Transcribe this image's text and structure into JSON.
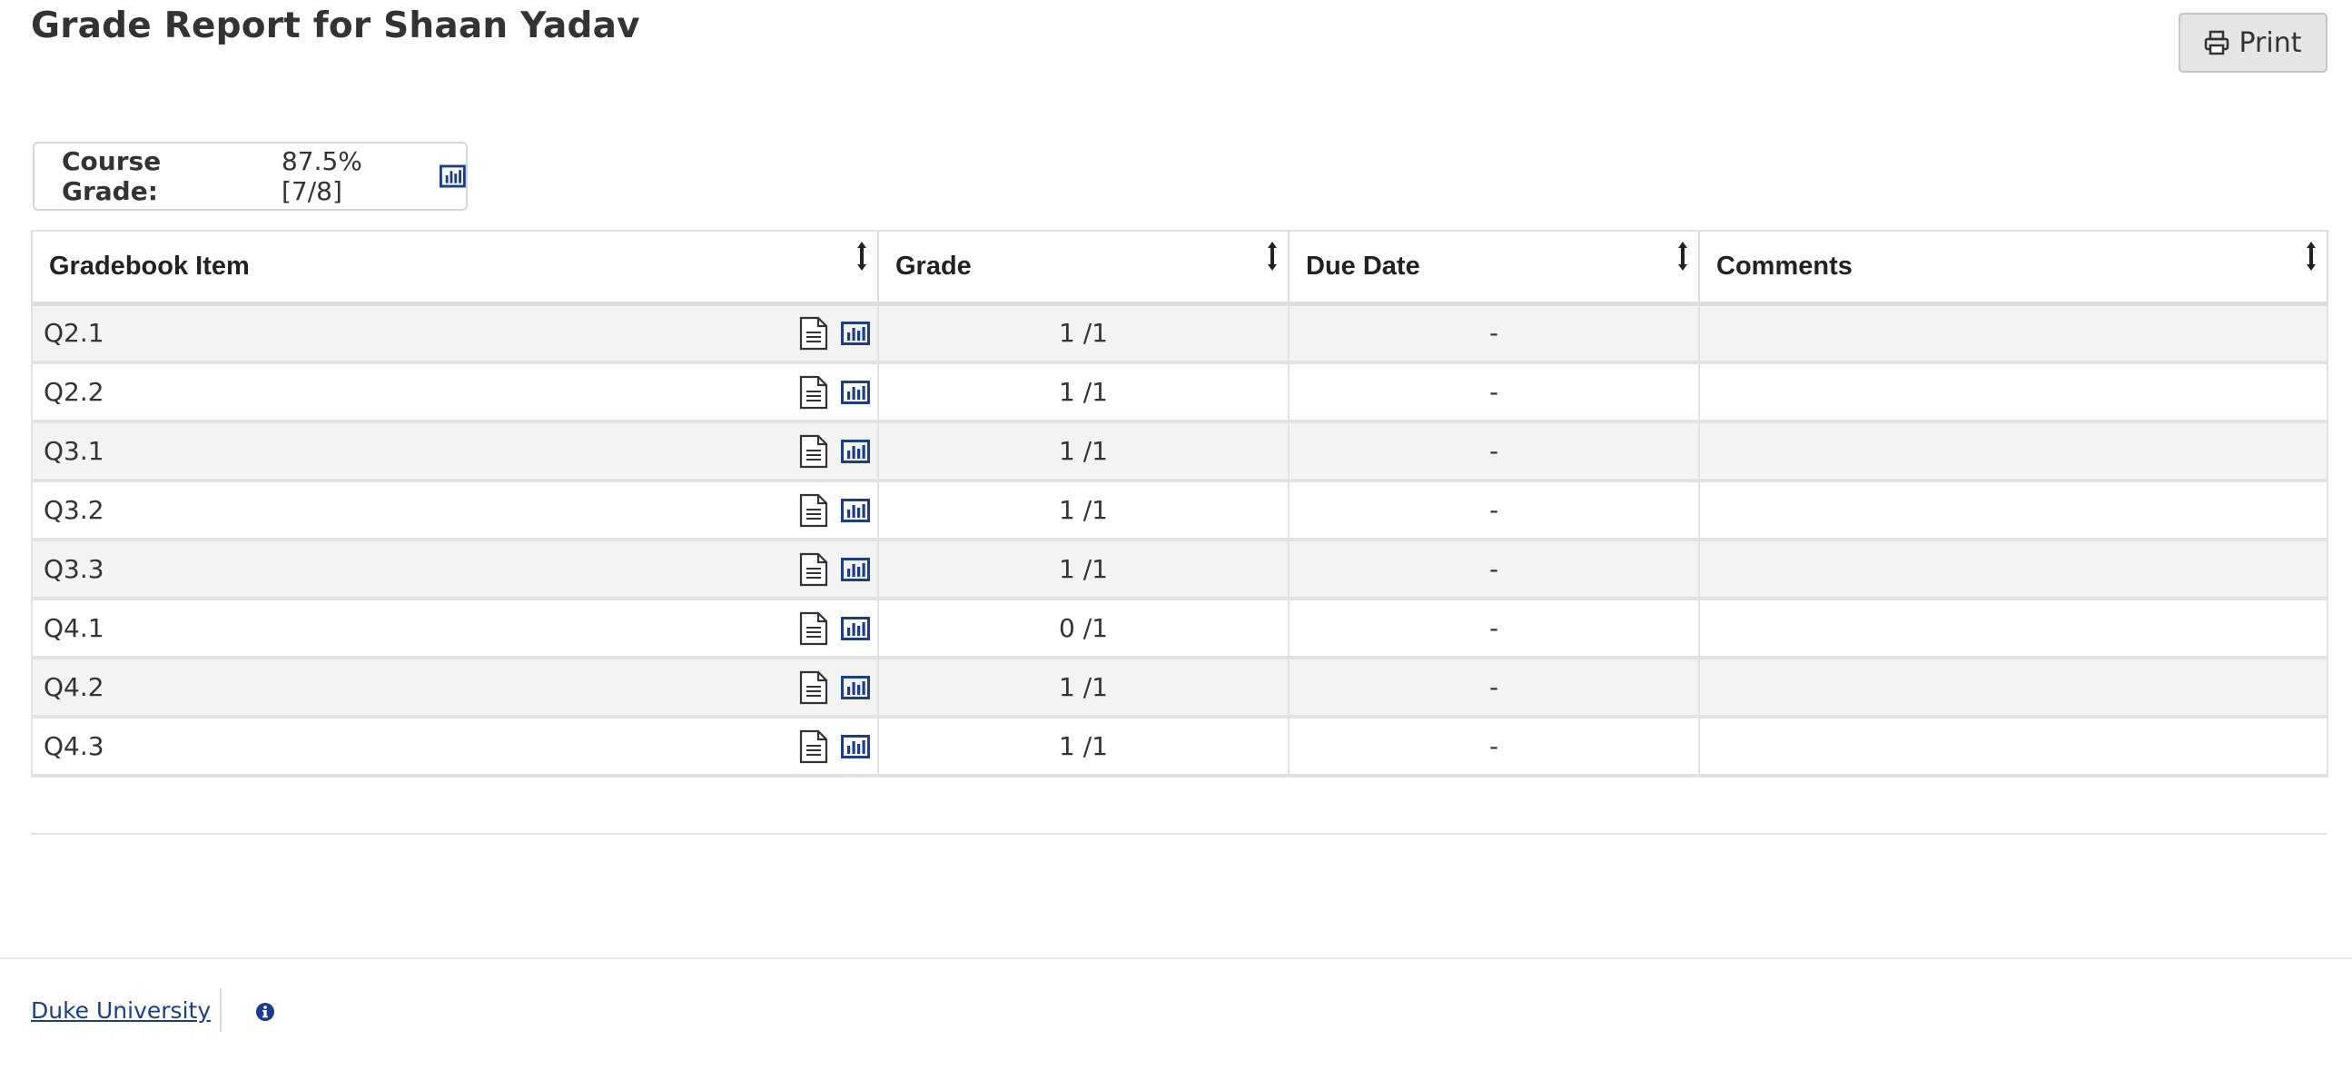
{
  "page": {
    "title": "Grade Report for Shaan Yadav",
    "print_label": "Print"
  },
  "course_grade": {
    "label": "Course Grade:",
    "value": "87.5% [7/8]"
  },
  "table": {
    "headers": [
      "Gradebook Item",
      "Grade",
      "Due Date",
      "Comments"
    ],
    "rows": [
      {
        "item": "Q2.1",
        "grade": "1 /1",
        "due": "-",
        "comments": ""
      },
      {
        "item": "Q2.2",
        "grade": "1 /1",
        "due": "-",
        "comments": ""
      },
      {
        "item": "Q3.1",
        "grade": "1 /1",
        "due": "-",
        "comments": ""
      },
      {
        "item": "Q3.2",
        "grade": "1 /1",
        "due": "-",
        "comments": ""
      },
      {
        "item": "Q3.3",
        "grade": "1 /1",
        "due": "-",
        "comments": ""
      },
      {
        "item": "Q4.1",
        "grade": "0 /1",
        "due": "-",
        "comments": ""
      },
      {
        "item": "Q4.2",
        "grade": "1 /1",
        "due": "-",
        "comments": ""
      },
      {
        "item": "Q4.3",
        "grade": "1 /1",
        "due": "-",
        "comments": ""
      }
    ]
  },
  "footer": {
    "link_label": "Duke University"
  },
  "icons": {
    "print": "printer-icon",
    "sort": "sort-icon",
    "details": "document-icon",
    "stats": "bar-chart-icon",
    "info": "info-icon"
  },
  "colors": {
    "link": "#1b3d8a",
    "stats_icon": "#1b3d8a",
    "row_alt": "#f3f3f3",
    "border": "#e2e2e2"
  }
}
